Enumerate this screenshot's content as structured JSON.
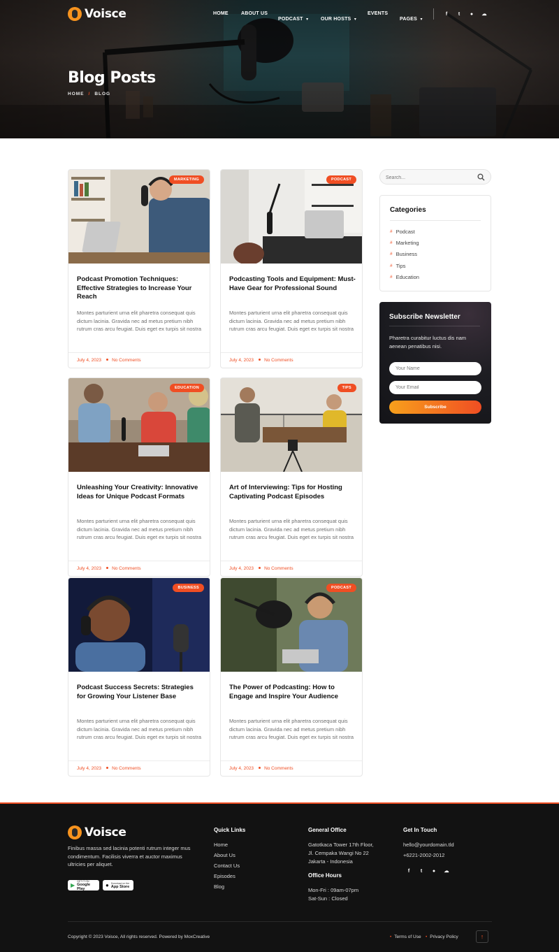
{
  "brand": {
    "name": "Voisce",
    "accent": "#f04e23",
    "accent_gradient_start": "#f7a01c"
  },
  "nav": {
    "items": [
      {
        "label": "HOME",
        "has_dropdown": false
      },
      {
        "label": "ABOUT US",
        "has_dropdown": false
      },
      {
        "label": "PODCAST",
        "has_dropdown": true
      },
      {
        "label": "OUR HOSTS",
        "has_dropdown": true
      },
      {
        "label": "EVENTS",
        "has_dropdown": false
      },
      {
        "label": "PAGES",
        "has_dropdown": true
      }
    ],
    "social_icons": [
      "facebook-icon",
      "twitter-icon",
      "dribbble-icon",
      "soundcloud-icon"
    ]
  },
  "hero": {
    "title": "Blog Posts",
    "breadcrumb": [
      "HOME",
      "BLOG"
    ]
  },
  "posts": [
    {
      "category": "MARKETING",
      "title": "Podcast Promotion Techniques: Effective Strategies to Increase Your Reach",
      "excerpt": "Montes parturient urna elit pharetra consequat quis dictum lacinia. Gravida nec ad metus pretium nibh rutrum cras arcu feugiat. Duis eget ex turpis sit nostra",
      "date": "July 4, 2023",
      "comments": "No Comments"
    },
    {
      "category": "PODCAST",
      "title": "Podcasting Tools and Equipment: Must-Have Gear for Professional Sound",
      "excerpt": "Montes parturient urna elit pharetra consequat quis dictum lacinia. Gravida nec ad metus pretium nibh rutrum cras arcu feugiat. Duis eget ex turpis sit nostra",
      "date": "July 4, 2023",
      "comments": "No Comments"
    },
    {
      "category": "EDUCATION",
      "title": "Unleashing Your Creativity: Innovative Ideas for Unique Podcast Formats",
      "excerpt": "Montes parturient urna elit pharetra consequat quis dictum lacinia. Gravida nec ad metus pretium nibh rutrum cras arcu feugiat. Duis eget ex turpis sit nostra",
      "date": "July 4, 2023",
      "comments": "No Comments"
    },
    {
      "category": "TIPS",
      "title": "Art of Interviewing: Tips for Hosting Captivating Podcast Episodes",
      "excerpt": "Montes parturient urna elit pharetra consequat quis dictum lacinia. Gravida nec ad metus pretium nibh rutrum cras arcu feugiat. Duis eget ex turpis sit nostra",
      "date": "July 4, 2023",
      "comments": "No Comments"
    },
    {
      "category": "BUSINESS",
      "title": "Podcast Success Secrets: Strategies for Growing Your Listener Base",
      "excerpt": "Montes parturient urna elit pharetra consequat quis dictum lacinia. Gravida nec ad metus pretium nibh rutrum cras arcu feugiat. Duis eget ex turpis sit nostra",
      "date": "July 4, 2023",
      "comments": "No Comments"
    },
    {
      "category": "PODCAST",
      "title": "The Power of Podcasting: How to Engage and Inspire Your Audience",
      "excerpt": "Montes parturient urna elit pharetra consequat quis dictum lacinia. Gravida nec ad metus pretium nibh rutrum cras arcu feugiat. Duis eget ex turpis sit nostra",
      "date": "July 4, 2023",
      "comments": "No Comments"
    }
  ],
  "sidebar": {
    "search_placeholder": "Search...",
    "categories_title": "Categories",
    "categories": [
      "Podcast",
      "Marketing",
      "Business",
      "Tips",
      "Education"
    ],
    "newsletter": {
      "title": "Subscribe Newsletter",
      "text": "Pharetra curabitur luctus dis nam aenean penatibus nisi.",
      "name_placeholder": "Your Name",
      "email_placeholder": "Your Email",
      "button": "Subscribe"
    }
  },
  "footer": {
    "brand": "Voisce",
    "about": "Finibus massa sed lacinia potenti rutrum integer mus condimentum. Facilisis viverra et auctor maximus ultricies per aliquet.",
    "google_play": {
      "small": "GET IT ON",
      "big": "Google Play"
    },
    "app_store": {
      "small": "Download on the",
      "big": "App Store"
    },
    "quick_links_title": "Quick Links",
    "quick_links": [
      "Home",
      "About Us",
      "Contact Us",
      "Episodes",
      "Blog"
    ],
    "office_title": "General Office",
    "office_address": [
      "Gatotkaca Tower 17th Floor,",
      "Jl. Cempaka Wangi No 22",
      "Jakarta - Indonesia"
    ],
    "hours_title": "Office Hours",
    "hours": [
      "Mon-Fri : 09am-07pm",
      "Sat-Sun : Closed"
    ],
    "contact_title": "Get In Touch",
    "email": "hello@yourdomain.tld",
    "phone": "+6221-2002-2012",
    "copyright": "Copyright © 2023 Voisce, All rights reserved. Powered by MoxCreative",
    "legal": [
      "Terms of Use",
      "Privacy Policy"
    ]
  }
}
